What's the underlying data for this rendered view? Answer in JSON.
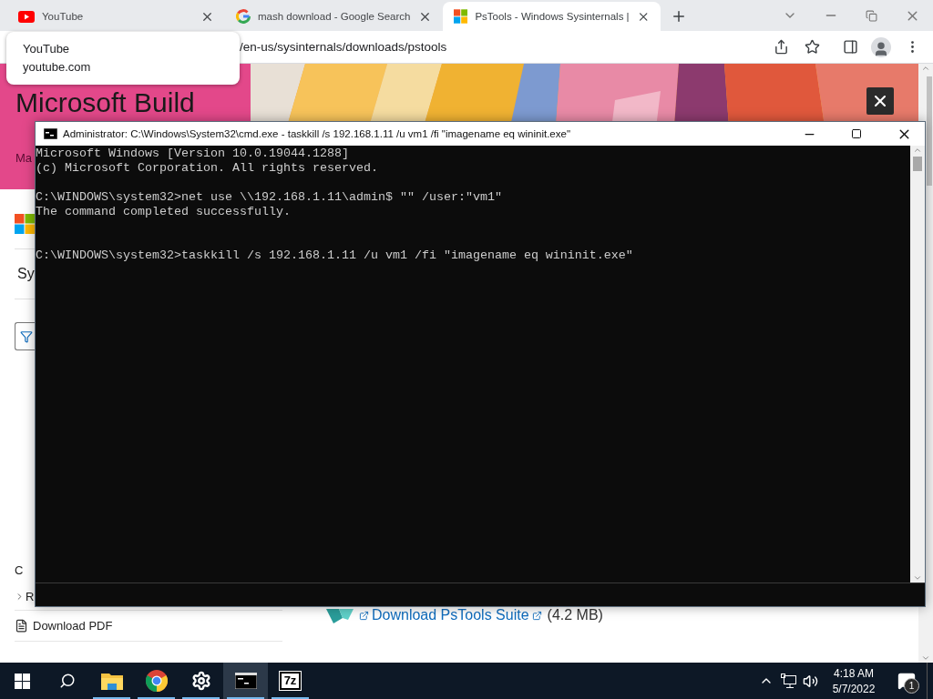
{
  "browser": {
    "tabs": [
      {
        "title": "YouTube",
        "kind": "youtube",
        "selected": false
      },
      {
        "title": "mash download - Google Search",
        "kind": "google",
        "selected": false
      },
      {
        "title": "PsTools - Windows Sysinternals |",
        "kind": "microsoft",
        "selected": true
      }
    ],
    "address": "/en-us/sysinternals/downloads/pstools",
    "tab_tooltip": {
      "title": "YouTube",
      "url": "youtube.com"
    }
  },
  "page": {
    "banner": {
      "heading": "Microsoft Build",
      "subtext": "Ma"
    },
    "sidebar": {
      "heading": "Sy",
      "items": [
        {
          "label": "C",
          "kind": "plain"
        },
        {
          "label": "R",
          "kind": "expandable"
        },
        {
          "label": "Download PDF",
          "kind": "pdf"
        }
      ]
    },
    "download": {
      "link": "Download PsTools Suite",
      "size": "(4.2 MB)"
    }
  },
  "console_window": {
    "title": "Administrator: C:\\Windows\\System32\\cmd.exe - taskkill  /s 192.168.1.11 /u vm1 /fi \"imagename eq wininit.exe\"",
    "lines": [
      {
        "kind": "output",
        "text": "Microsoft Windows [Version 10.0.19044.1288]"
      },
      {
        "kind": "output",
        "text": "(c) Microsoft Corporation. All rights reserved."
      },
      {
        "kind": "blank"
      },
      {
        "kind": "output",
        "text": "C:\\WINDOWS\\system32>net use \\\\192.168.1.11\\admin$ \"\" /user:\"vm1\""
      },
      {
        "kind": "output",
        "text": "The command completed successfully."
      },
      {
        "kind": "blank"
      },
      {
        "kind": "blank"
      },
      {
        "kind": "output",
        "text": "C:\\WINDOWS\\system32>taskkill /s 192.168.1.11 /u vm1 /fi \"imagename eq wininit.exe\""
      }
    ]
  },
  "taskbar": {
    "apps": [
      {
        "kind": "start",
        "running": false,
        "selected": false
      },
      {
        "kind": "search",
        "running": false,
        "selected": false
      },
      {
        "kind": "explorer",
        "running": true,
        "selected": false
      },
      {
        "kind": "chrome",
        "running": true,
        "selected": false
      },
      {
        "kind": "settings",
        "running": true,
        "selected": false
      },
      {
        "kind": "console",
        "running": true,
        "selected": true
      },
      {
        "kind": "archiver",
        "running": true,
        "selected": false,
        "logo_text": "7z"
      }
    ],
    "clock": {
      "time": "4:18 AM",
      "date": "5/7/2022"
    },
    "notification_count": "1"
  }
}
